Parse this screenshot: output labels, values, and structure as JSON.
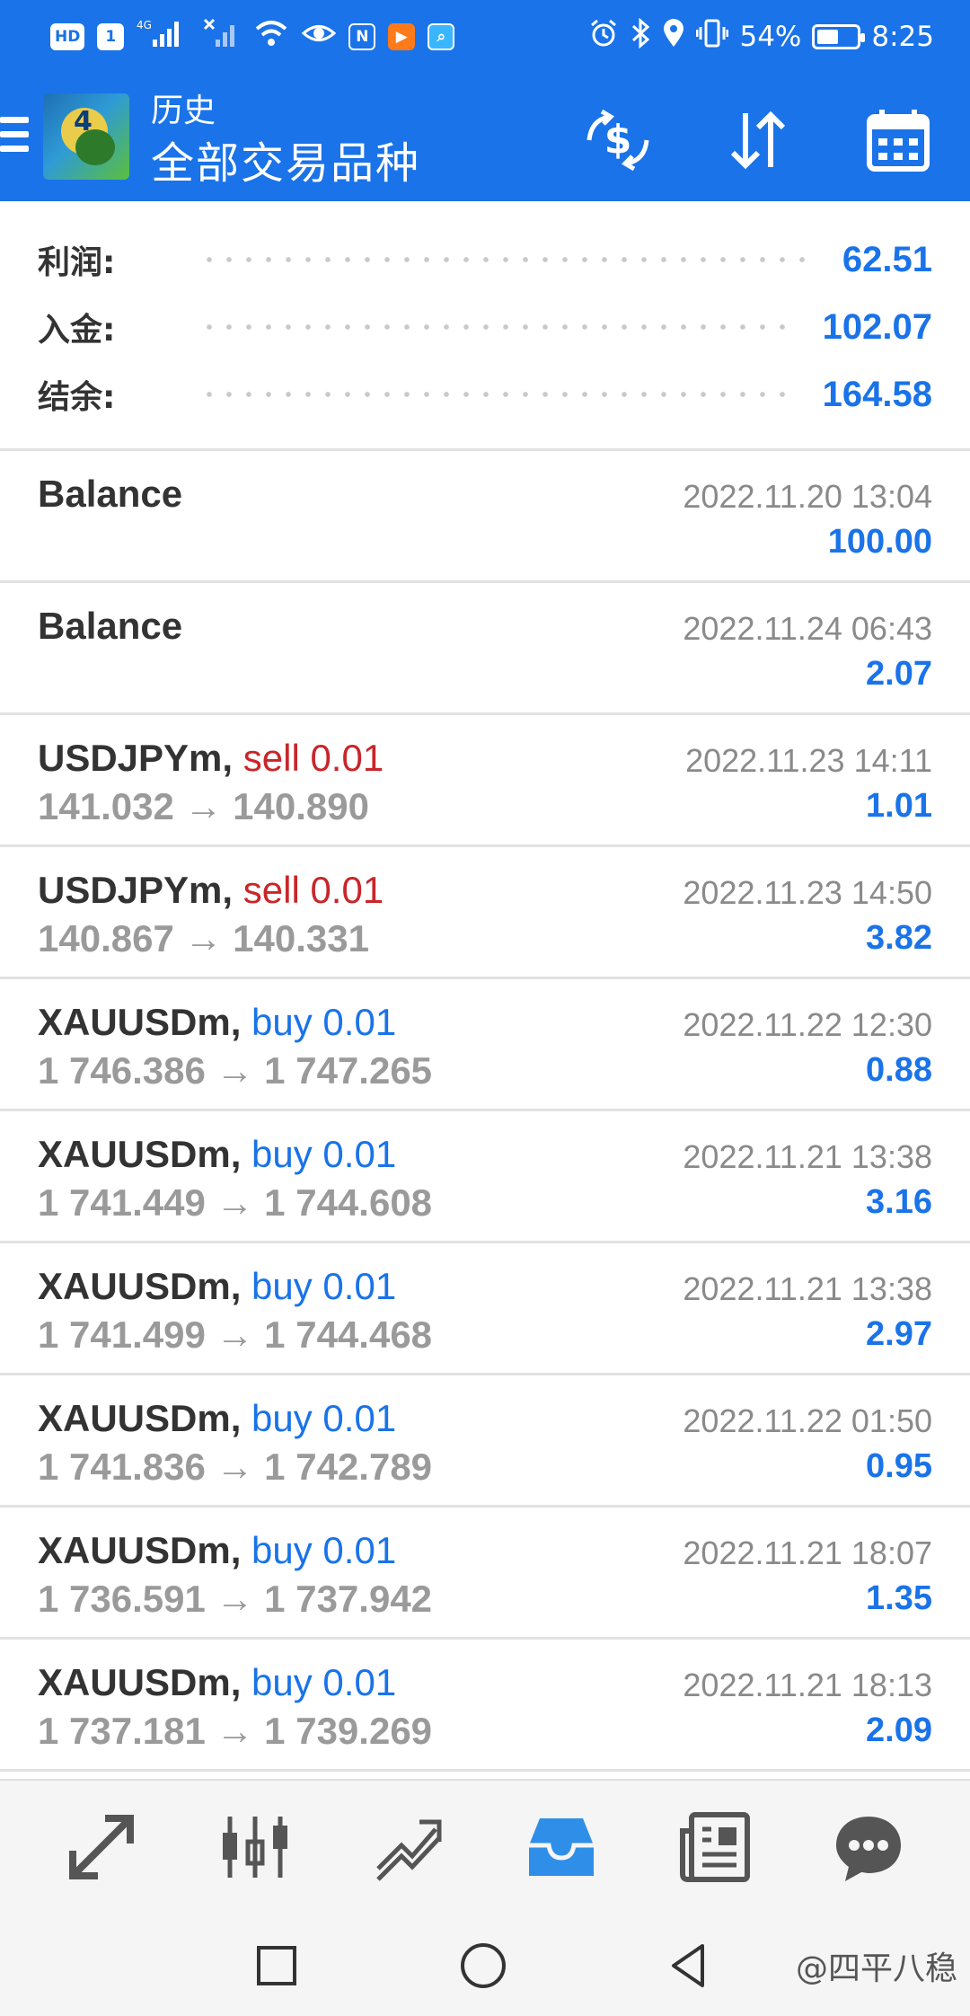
{
  "status_bar": {
    "chips": [
      "HD",
      "1",
      "N"
    ],
    "signal_label": "4G",
    "battery": "54%",
    "battery_level": 0.54,
    "time": "8:25"
  },
  "app_bar": {
    "subtitle": "历史",
    "title": "全部交易品种",
    "logo_label": "4",
    "actions": [
      "currency-swap-icon",
      "sort-icon",
      "calendar-icon"
    ]
  },
  "summary": {
    "profit_label": "利润:",
    "profit_value": "62.51",
    "deposit_label": "入金:",
    "deposit_value": "102.07",
    "balance_label": "结余:",
    "balance_value": "164.58"
  },
  "history": [
    {
      "symbol": "Balance",
      "side": "",
      "side_type": "",
      "prices": "",
      "date": "2022.11.20 13:04",
      "profit": "100.00"
    },
    {
      "symbol": "Balance",
      "side": "",
      "side_type": "",
      "prices": "",
      "date": "2022.11.24 06:43",
      "profit": "2.07"
    },
    {
      "symbol": "USDJPYm, ",
      "side": "sell 0.01",
      "side_type": "sell",
      "prices": "141.032 → 140.890",
      "date": "2022.11.23 14:11",
      "profit": "1.01"
    },
    {
      "symbol": "USDJPYm, ",
      "side": "sell 0.01",
      "side_type": "sell",
      "prices": "140.867 → 140.331",
      "date": "2022.11.23 14:50",
      "profit": "3.82"
    },
    {
      "symbol": "XAUUSDm, ",
      "side": "buy 0.01",
      "side_type": "buy",
      "prices": "1 746.386 → 1 747.265",
      "date": "2022.11.22 12:30",
      "profit": "0.88"
    },
    {
      "symbol": "XAUUSDm, ",
      "side": "buy 0.01",
      "side_type": "buy",
      "prices": "1 741.449 → 1 744.608",
      "date": "2022.11.21 13:38",
      "profit": "3.16"
    },
    {
      "symbol": "XAUUSDm, ",
      "side": "buy 0.01",
      "side_type": "buy",
      "prices": "1 741.499 → 1 744.468",
      "date": "2022.11.21 13:38",
      "profit": "2.97"
    },
    {
      "symbol": "XAUUSDm, ",
      "side": "buy 0.01",
      "side_type": "buy",
      "prices": "1 741.836 → 1 742.789",
      "date": "2022.11.22 01:50",
      "profit": "0.95"
    },
    {
      "symbol": "XAUUSDm, ",
      "side": "buy 0.01",
      "side_type": "buy",
      "prices": "1 736.591 → 1 737.942",
      "date": "2022.11.21 18:07",
      "profit": "1.35"
    },
    {
      "symbol": "XAUUSDm, ",
      "side": "buy 0.01",
      "side_type": "buy",
      "prices": "1 737.181 → 1 739.269",
      "date": "2022.11.21 18:13",
      "profit": "2.09"
    }
  ],
  "bottom_nav": {
    "items": [
      "quotes-icon",
      "chart-icon",
      "trade-icon",
      "history-icon",
      "news-icon",
      "chat-icon"
    ],
    "active": "history-icon"
  },
  "system_nav": {
    "items": [
      "recents-icon",
      "home-icon",
      "back-icon"
    ],
    "watermark": "@四平八稳"
  },
  "colors": {
    "primary": "#1a73e8",
    "sell": "#c8262a",
    "buy": "#1a73e8",
    "muted": "#9a9a9a"
  }
}
